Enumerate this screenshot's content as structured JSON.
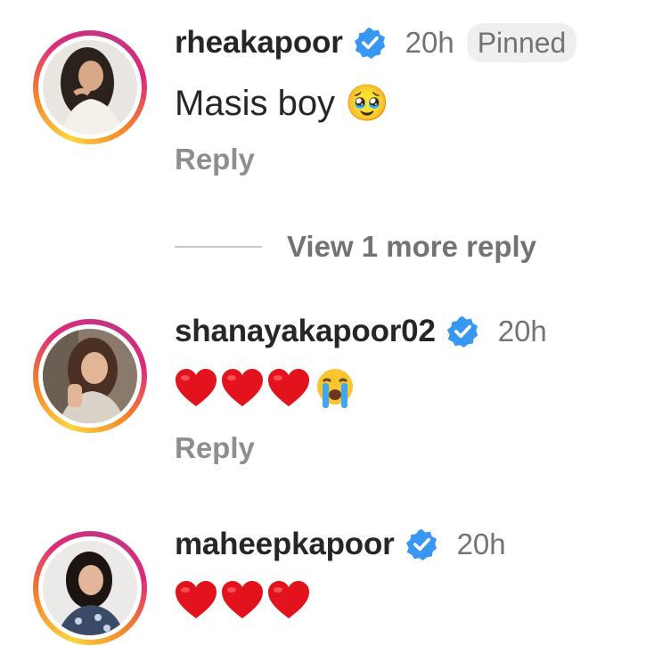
{
  "comments": [
    {
      "username": "rheakapoor",
      "time": "20h",
      "pinned_label": "Pinned",
      "text": "Masis boy 🥹",
      "reply_label": "Reply"
    },
    {
      "username": "shanayakapoor02",
      "time": "20h",
      "emojis": [
        "red-heart",
        "red-heart",
        "red-heart",
        "loudly-crying-face"
      ],
      "reply_label": "Reply"
    },
    {
      "username": "maheepkapoor",
      "time": "20h",
      "emojis": [
        "red-heart",
        "red-heart",
        "red-heart"
      ]
    }
  ],
  "view_more_replies": "View 1 more reply",
  "colors": {
    "verified_blue": "#3897f0",
    "heart_red": "#e3131e",
    "ring_gradient": [
      "#fbd43e",
      "#f58529",
      "#dd2a7b",
      "#c13584"
    ]
  }
}
